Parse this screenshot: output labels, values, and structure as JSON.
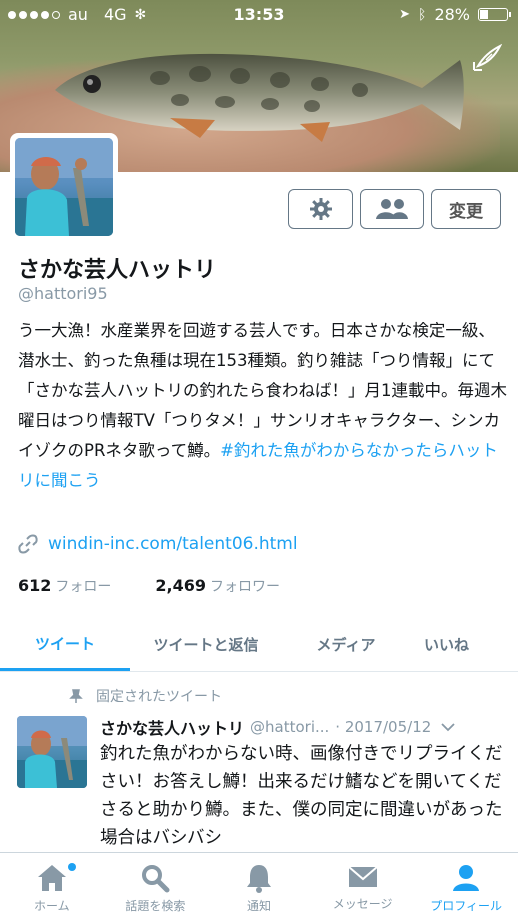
{
  "status_bar": {
    "carrier": "au",
    "network": "4G",
    "time": "13:53",
    "battery": "28%"
  },
  "profile": {
    "name": "さかな芸人ハットリ",
    "handle": "@hattori95",
    "bio_text": "う一大漁！水産業界を回遊する芸人です。日本さかな検定一級、潜水士、釣った魚種は現在153種類。釣り雑誌「つり情報」にて「さかな芸人ハットリの釣れたら食わねば！」月1連載中。毎週木曜日はつり情報TV「つりタメ！」サンリオキャラクター、シンカイゾクのPRネタ歌って鱒。",
    "bio_hashtag": "#釣れた魚がわからなかったらハットリに聞こう",
    "url": "windin-inc.com/talent06.html",
    "following_count": "612",
    "following_label": "フォロー",
    "followers_count": "2,469",
    "followers_label": "フォロワー",
    "edit_button": "変更"
  },
  "tabs": [
    "ツイート",
    "ツイートと返信",
    "メディア",
    "いいね"
  ],
  "pinned_tweet": {
    "pinned_label": "固定されたツイート",
    "author_name": "さかな芸人ハットリ",
    "author_handle": "@hattori...",
    "date": "· 2017/05/12",
    "text": "釣れた魚がわからない時、画像付きでリプライください！お答えし鱒！出来るだけ鰭などを開いてくださると助かり鱒。また、僕の同定に間違いがあった場合はバシバシ"
  },
  "bottom_nav": [
    "ホーム",
    "話題を検索",
    "通知",
    "メッセージ",
    "プロフィール"
  ],
  "colors": {
    "accent": "#1da1f2",
    "muted": "#8899a6"
  }
}
